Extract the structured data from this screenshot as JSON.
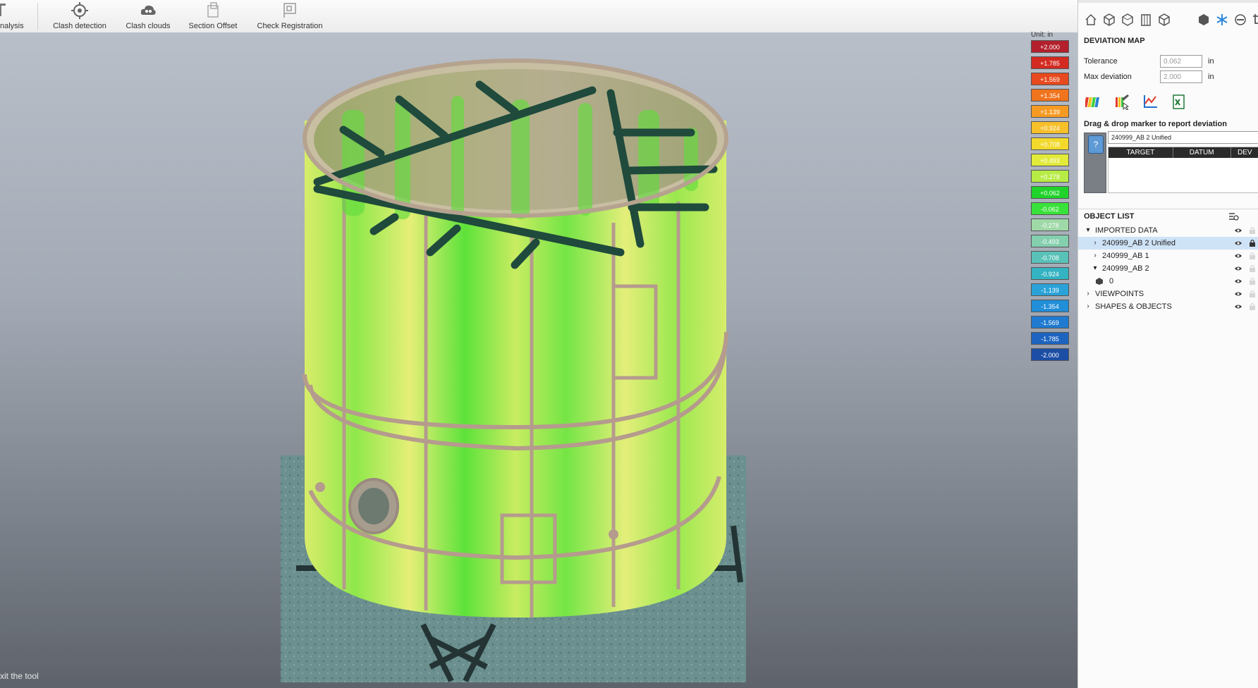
{
  "toolbar": {
    "items": [
      {
        "label": "nalysis",
        "icon": "analysis-icon"
      },
      {
        "label": "Clash detection",
        "icon": "clash-detection-icon"
      },
      {
        "label": "Clash clouds",
        "icon": "clash-clouds-icon"
      },
      {
        "label": "Section Offset",
        "icon": "section-offset-icon"
      },
      {
        "label": "Check Registration",
        "icon": "check-registration-icon"
      }
    ]
  },
  "viewport": {
    "status_text": "xit the tool",
    "legend": {
      "unit_label": "Unit: in",
      "entries": [
        {
          "value": "+2.000",
          "color": "#b3202b"
        },
        {
          "value": "+1.785",
          "color": "#d32a21"
        },
        {
          "value": "+1.569",
          "color": "#e74a1e"
        },
        {
          "value": "+1.354",
          "color": "#f0731d"
        },
        {
          "value": "+1.139",
          "color": "#f59a22"
        },
        {
          "value": "+0.924",
          "color": "#f6c02a"
        },
        {
          "value": "+0.708",
          "color": "#f2d92c"
        },
        {
          "value": "+0.493",
          "color": "#e2ea3a"
        },
        {
          "value": "+0.278",
          "color": "#b7eb45"
        },
        {
          "value": "+0.062",
          "color": "#1fd32a"
        },
        {
          "value": "-0.062",
          "color": "#39e23a"
        },
        {
          "value": "-0.278",
          "color": "#9fd9a8"
        },
        {
          "value": "-0.493",
          "color": "#84cfae"
        },
        {
          "value": "-0.708",
          "color": "#59c2b8"
        },
        {
          "value": "-0.924",
          "color": "#34b3c2"
        },
        {
          "value": "-1.139",
          "color": "#2aa2d8"
        },
        {
          "value": "-1.354",
          "color": "#218ed8"
        },
        {
          "value": "-1.569",
          "color": "#1f7ad0"
        },
        {
          "value": "-1.785",
          "color": "#1d64c0"
        },
        {
          "value": "-2.000",
          "color": "#1c4ea5"
        }
      ]
    }
  },
  "panel": {
    "icons": [
      "home-icon",
      "cube-icon",
      "cube-wire-icon",
      "building-icon",
      "box-icon",
      "solid-cube-icon",
      "snowflake-icon",
      "circle-icon",
      "crop-icon"
    ],
    "deviation_map": {
      "title": "DEVIATION MAP",
      "tolerance_label": "Tolerance",
      "tolerance_value": "0.062",
      "tolerance_unit": "in",
      "max_dev_label": "Max deviation",
      "max_dev_value": "2.000",
      "max_dev_unit": "in",
      "tools": [
        "rainbow-scale-icon",
        "deviation-edit-icon",
        "chart-axes-icon",
        "export-excel-icon"
      ]
    },
    "marker": {
      "title": "Drag & drop marker to report deviation",
      "selected_cloud": "240999_AB 2 Unified",
      "pin_glyph": "?",
      "columns": [
        "TARGET",
        "DATUM",
        "DEV"
      ]
    },
    "object_list": {
      "title": "OBJECT LIST",
      "rows": [
        {
          "label": "IMPORTED DATA",
          "arrow": "▾",
          "level": 0,
          "selected": false,
          "lock": false
        },
        {
          "label": "240999_AB 2 Unified",
          "arrow": "›",
          "level": 1,
          "selected": true,
          "lock": true
        },
        {
          "label": "240999_AB 1",
          "arrow": "›",
          "level": 1,
          "selected": false,
          "lock": false
        },
        {
          "label": "240999_AB 2",
          "arrow": "▾",
          "level": 1,
          "selected": false,
          "lock": false
        },
        {
          "label": "0",
          "arrow": "",
          "level": 2,
          "selected": false,
          "lock": false
        },
        {
          "label": "VIEWPOINTS",
          "arrow": "›",
          "level": 0,
          "selected": false,
          "lock": false
        },
        {
          "label": "SHAPES & OBJECTS",
          "arrow": "›",
          "level": 0,
          "selected": false,
          "lock": false
        }
      ]
    }
  }
}
